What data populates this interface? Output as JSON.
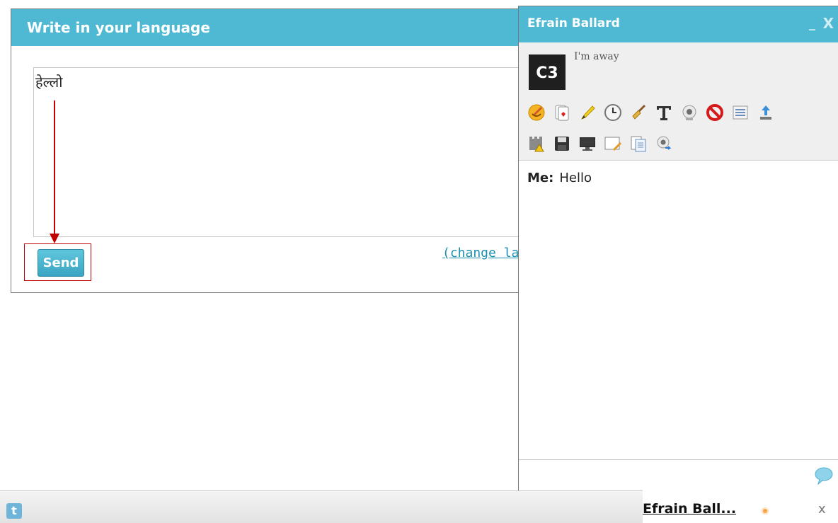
{
  "translate_dialog": {
    "title": "Write in your language",
    "input_text": "हेल्लो",
    "send_label": "Send",
    "change_language_link": "(change la"
  },
  "chat_window": {
    "title": "Efrain Ballard",
    "minimize": "_",
    "close": "X",
    "avatar_text": "C3",
    "status": "I'm away",
    "toolbar_icons": [
      "smiley-icon",
      "playing-cards-icon",
      "pencil-icon",
      "clock-icon",
      "broom-icon",
      "text-format-icon",
      "webcam-icon",
      "block-icon",
      "list-icon",
      "upload-icon",
      "castle-warning-icon",
      "save-icon",
      "monitor-icon",
      "whiteboard-icon",
      "document-icon",
      "webcam-share-icon"
    ],
    "messages": [
      {
        "sender": "Me:",
        "text": "Hello"
      }
    ]
  },
  "bottom_bar": {
    "twitter_icon": "t",
    "chat_tab_name": "Efrain Ball...",
    "chat_tab_close": "x",
    "status_color": "#f5a64a"
  },
  "colors": {
    "accent": "#4fb9d3",
    "annotation": "#c00000"
  }
}
